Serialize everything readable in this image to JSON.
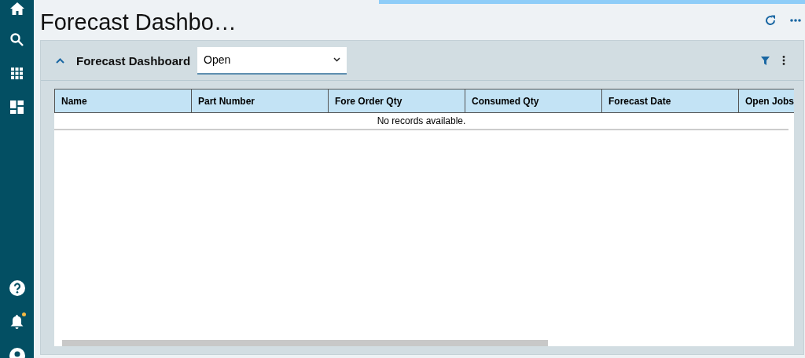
{
  "sidebar": {
    "top_items": [
      {
        "kind": "home"
      },
      {
        "kind": "search"
      },
      {
        "kind": "apps"
      },
      {
        "kind": "dashboard"
      }
    ],
    "bottom_items": [
      {
        "kind": "help"
      },
      {
        "kind": "notifications",
        "notification": true
      },
      {
        "kind": "account"
      }
    ]
  },
  "page": {
    "title": "Forecast Dashbo…"
  },
  "panel": {
    "title": "Forecast Dashboard",
    "expanded": true,
    "filter": {
      "value": "Open"
    },
    "table": {
      "columns": [
        "Name",
        "Part Number",
        "Fore Order Qty",
        "Consumed Qty",
        "Forecast Date",
        "Open Jobs"
      ],
      "empty_message": "No records available."
    }
  }
}
